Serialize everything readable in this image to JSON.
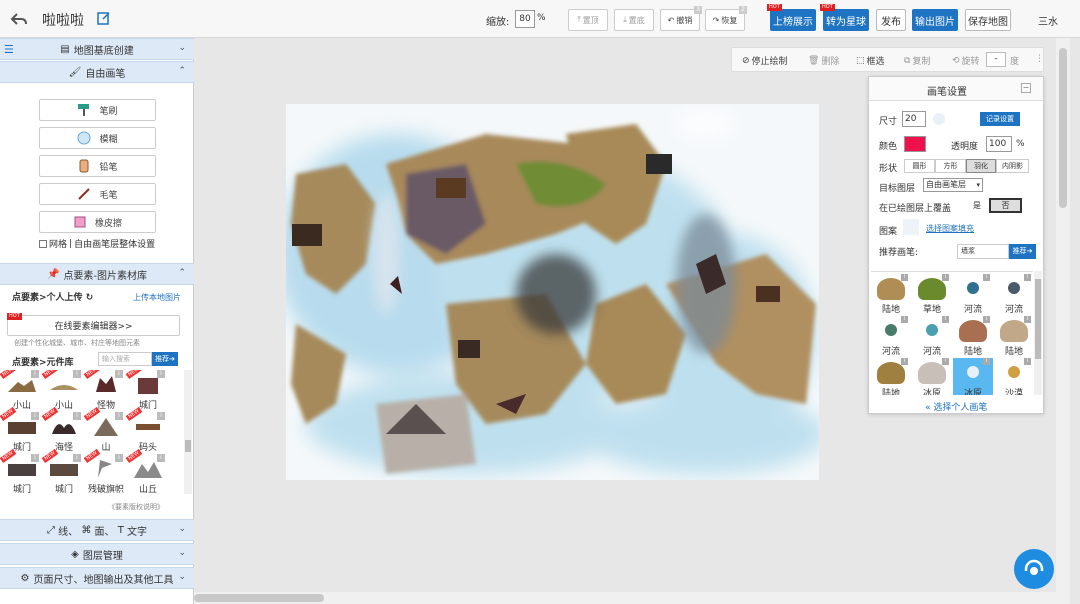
{
  "topbar": {
    "title": "啦啦啦",
    "zoom_label": "缩放:",
    "zoom_value": "80",
    "zoom_unit": "%",
    "btn_top": "置顶",
    "btn_bottom": "置底",
    "btn_undo": "撤销",
    "btn_undo_count": "3",
    "btn_redo": "恢复",
    "btn_redo_count": "2",
    "btn_upload_show": "上榜展示",
    "btn_to_globe": "转为星球",
    "btn_publish": "发布",
    "btn_export": "输出图片",
    "btn_save": "保存地图",
    "hot": "HOT",
    "user": "三水"
  },
  "sidebar": {
    "sec_base": "地图基底创建",
    "sec_freedraw": "自由画笔",
    "tools": [
      "笔刷",
      "模糊",
      "铅笔",
      "毛笔",
      "橡皮擦"
    ],
    "grid_label": "网格",
    "brush_layer_settings": "自由画笔层整体设置",
    "sec_elements": "点要素-图片素材库",
    "personal_upload": "点要素>个人上传",
    "upload_local": "上传本地图片",
    "online_editor": "在线要素编辑器>>",
    "online_editor_desc": "创建个性化城堡、城市、村庄等地图元素",
    "component_lib": "点要素>元件库",
    "search_placeholder": "输入搜索",
    "recommend": "推荐",
    "elements": [
      "小山",
      "小山",
      "怪物",
      "城门",
      "城门",
      "海怪",
      "山",
      "码头",
      "城门",
      "城门",
      "残破旗帜",
      "山丘"
    ],
    "copyright_note": "《要素版权说明》",
    "sec_line": "线、",
    "sec_area": "面、",
    "sec_text": "文字",
    "sec_layers": "图层管理",
    "sec_page": "页面尺寸、地图输出及其他工具"
  },
  "drawbar": {
    "stop": "停止绘制",
    "delete": "删除",
    "select": "框选",
    "copy": "复制",
    "rotate": "旋转",
    "rotate_value": "-",
    "degree": "度"
  },
  "brush_panel": {
    "title": "画笔设置",
    "size_label": "尺寸",
    "size_value": "20",
    "record_settings": "记录设置",
    "color_label": "颜色",
    "color_value": "#f0104c",
    "opacity_label": "透明度",
    "opacity_value": "100",
    "opacity_unit": "%",
    "shape_label": "形状",
    "shapes": [
      "圆形",
      "方形",
      "羽化",
      "内阴影"
    ],
    "target_layer_label": "目标图层",
    "target_layer_value": "自由画笔层",
    "overlay_label": "在已绘图层上覆盖",
    "overlay_yes": "是",
    "overlay_no": "否",
    "pattern_label": "图案",
    "pattern_fill_link": "选择图案填充",
    "recommended_label": "推荐画笔:",
    "recommended_value": "墙浆",
    "recommend_btn": "推荐",
    "swatches": [
      {
        "label": "陆地",
        "color": "#b08d55"
      },
      {
        "label": "草地",
        "color": "#6b8a2e"
      },
      {
        "label": "河流",
        "color": "#2f6f8f"
      },
      {
        "label": "河流",
        "color": "#4a5a6a"
      },
      {
        "label": "河流",
        "color": "#4a7a6a"
      },
      {
        "label": "河流",
        "color": "#4aa0b0"
      },
      {
        "label": "陆地",
        "color": "#a87050"
      },
      {
        "label": "陆地",
        "color": "#c0a888"
      },
      {
        "label": "陆地",
        "color": "#a08040"
      },
      {
        "label": "冰原",
        "color": "#c8c0b8"
      },
      {
        "label": "冰原",
        "color": "#e8f0f8"
      },
      {
        "label": "沙漠",
        "color": "#d0a040"
      }
    ],
    "select_personal": "« 选择个人画笔"
  },
  "colors": {
    "accent_blue": "#1e73c2",
    "hot_red": "#e02020",
    "section_bg": "#dde9f7"
  }
}
